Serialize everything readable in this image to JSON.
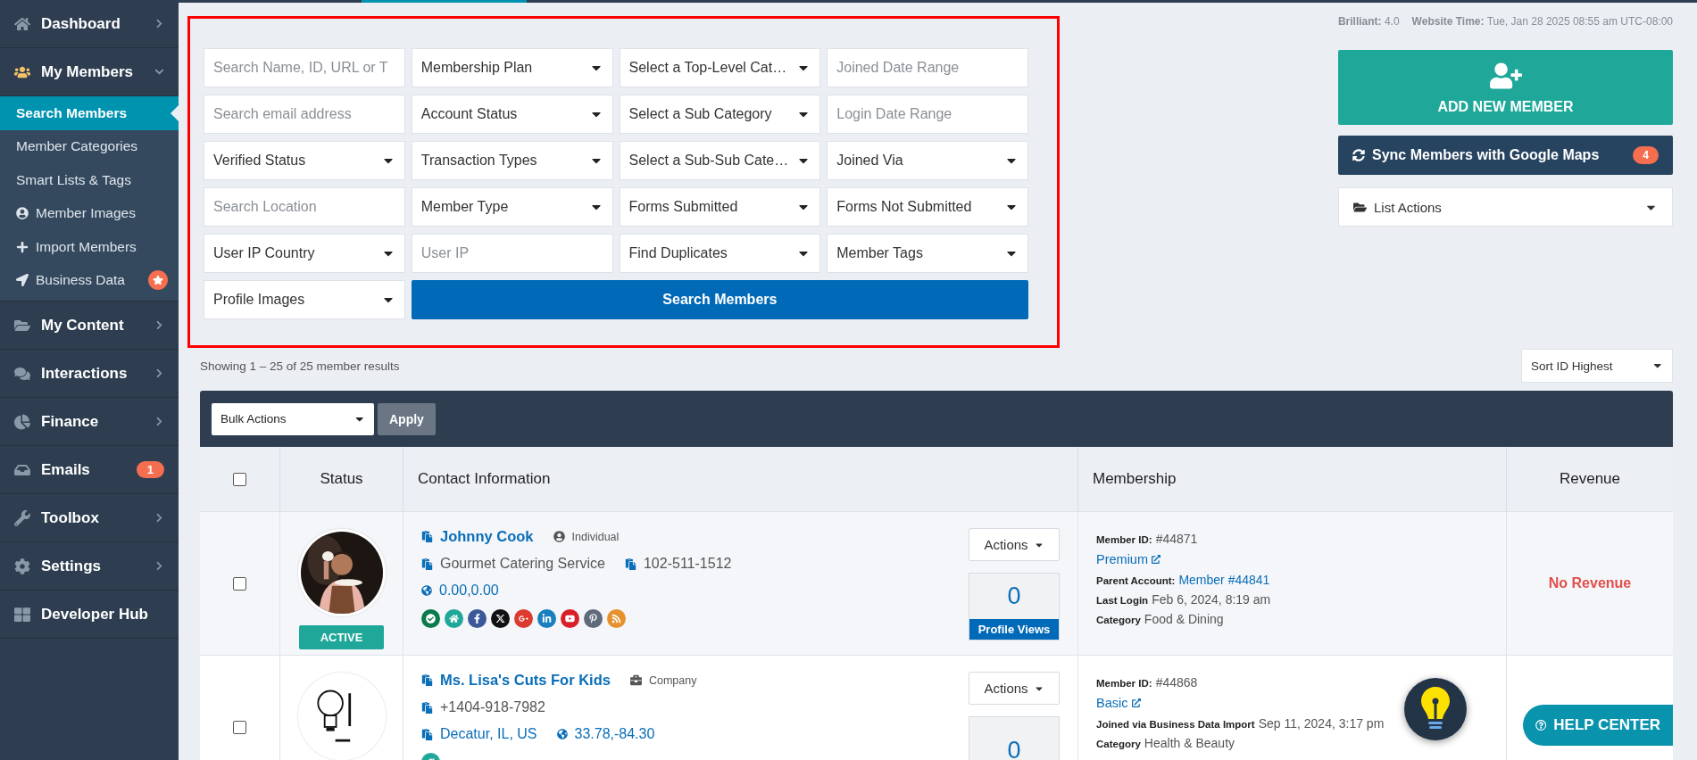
{
  "sidebar": {
    "items": [
      {
        "label": "Dashboard",
        "kind": "menu",
        "expanded": false
      },
      {
        "label": "My Members",
        "kind": "menu",
        "expanded": true,
        "children": [
          {
            "label": "Search Members",
            "selected": true,
            "starred": false
          },
          {
            "label": "Member Categories",
            "selected": false,
            "starred": false
          },
          {
            "label": "Smart Lists & Tags",
            "selected": false,
            "starred": false
          },
          {
            "label": "Member Images",
            "selected": false,
            "starred": false
          },
          {
            "label": "Import Members",
            "selected": false,
            "starred": false
          },
          {
            "label": "Business Data",
            "selected": false,
            "starred": true
          }
        ]
      },
      {
        "label": "My Content",
        "kind": "menu",
        "expanded": false
      },
      {
        "label": "Interactions",
        "kind": "menu",
        "expanded": false
      },
      {
        "label": "Finance",
        "kind": "menu",
        "expanded": false
      },
      {
        "label": "Emails",
        "kind": "link",
        "badge": "1"
      },
      {
        "label": "Toolbox",
        "kind": "menu",
        "expanded": false
      },
      {
        "label": "Settings",
        "kind": "menu",
        "expanded": false
      },
      {
        "label": "Developer Hub",
        "kind": "link"
      }
    ]
  },
  "filters": {
    "fields": [
      {
        "kind": "input",
        "placeholder": "Search Name, ID, URL or T"
      },
      {
        "kind": "select",
        "value": "Membership Plan"
      },
      {
        "kind": "select",
        "value": "Select a Top-Level Cat…"
      },
      {
        "kind": "input",
        "placeholder": "Joined Date Range"
      },
      {
        "kind": "input",
        "placeholder": "Search email address"
      },
      {
        "kind": "select",
        "value": "Account Status"
      },
      {
        "kind": "select",
        "value": "Select a Sub Category"
      },
      {
        "kind": "input",
        "placeholder": "Login Date Range"
      },
      {
        "kind": "select",
        "value": "Verified Status"
      },
      {
        "kind": "select",
        "value": "Transaction Types"
      },
      {
        "kind": "select",
        "value": "Select a Sub-Sub Cate…"
      },
      {
        "kind": "select",
        "value": "Joined Via"
      },
      {
        "kind": "input",
        "placeholder": "Search Location"
      },
      {
        "kind": "select",
        "value": "Member Type"
      },
      {
        "kind": "select",
        "value": "Forms Submitted"
      },
      {
        "kind": "select",
        "value": "Forms Not Submitted"
      },
      {
        "kind": "select",
        "value": "User IP Country"
      },
      {
        "kind": "input",
        "placeholder": "User IP"
      },
      {
        "kind": "select",
        "value": "Find Duplicates"
      },
      {
        "kind": "select",
        "value": "Member Tags"
      },
      {
        "kind": "select",
        "value": "Profile Images"
      }
    ],
    "search_button": "Search Members"
  },
  "meta": [
    {
      "label": "Brilliant:",
      "value": "4.0"
    },
    {
      "label": "Website Time:",
      "value": "Tue, Jan 28 2025 08:55 am UTC-08:00"
    }
  ],
  "actions": {
    "add_member": "ADD NEW MEMBER",
    "sync": "Sync Members with Google Maps",
    "sync_count": "4",
    "list_actions": "List Actions"
  },
  "results": {
    "summary": "Showing 1 – 25 of 25 member results",
    "sort": "Sort ID Highest"
  },
  "table": {
    "bulk_actions": "Bulk Actions",
    "apply": "Apply",
    "select_all_checked": false,
    "columns": [
      "Status",
      "Contact Information",
      "Membership",
      "Revenue"
    ],
    "rows": [
      {
        "checked": false,
        "status": "ACTIVE",
        "name": "Johnny Cook",
        "type": "Individual",
        "contact": [
          [
            {
              "kind": "plain",
              "text": "Gourmet Catering Service"
            },
            {
              "kind": "plain",
              "text": "102-511-1512"
            }
          ],
          [
            {
              "kind": "geo",
              "text": "0.00,0.00"
            }
          ]
        ],
        "social": [
          {
            "color": "#0b7a4b"
          },
          {
            "color": "#1fa89a"
          },
          {
            "color": "#3b5998"
          },
          {
            "color": "#111111"
          },
          {
            "color": "#dd3b2f"
          },
          {
            "color": "#1a7fbf"
          },
          {
            "color": "#d8202a"
          },
          {
            "color": "#5f6b7a"
          },
          {
            "color": "#e6912e"
          }
        ],
        "actions": "Actions",
        "views": "0",
        "views_label": "Profile Views",
        "membership": [
          {
            "kind": "field",
            "label": "Member ID:",
            "value": "#44871"
          },
          {
            "kind": "plan",
            "value": "Premium"
          },
          {
            "kind": "link",
            "label": "Parent Account:",
            "value": "Member #44841"
          },
          {
            "kind": "field",
            "label": "Last Login",
            "value": "Feb 6, 2024, 8:19 am"
          },
          {
            "kind": "field",
            "label": "Category",
            "value": "Food & Dining"
          }
        ],
        "revenue": "No Revenue"
      },
      {
        "checked": false,
        "name": "Ms. Lisa's Cuts For Kids",
        "type": "Company",
        "contact": [
          [
            {
              "kind": "plain",
              "text": "+1404-918-7982"
            }
          ],
          [
            {
              "kind": "link",
              "text": "Decatur, IL, US"
            },
            {
              "kind": "geo",
              "text": "33.78,-84.30"
            }
          ]
        ],
        "social": [
          {
            "color": "#1fa89a"
          }
        ],
        "actions": "Actions",
        "views": "0",
        "membership": [
          {
            "kind": "field",
            "label": "Member ID:",
            "value": "#44868"
          },
          {
            "kind": "plan",
            "value": "Basic"
          },
          {
            "kind": "field",
            "label": "Joined via Business Data Import",
            "value": "Sep 11, 2024, 3:17 pm"
          },
          {
            "kind": "field",
            "label": "Category",
            "value": "Health & Beauty"
          }
        ]
      }
    ]
  },
  "help": {
    "label": "HELP CENTER"
  }
}
